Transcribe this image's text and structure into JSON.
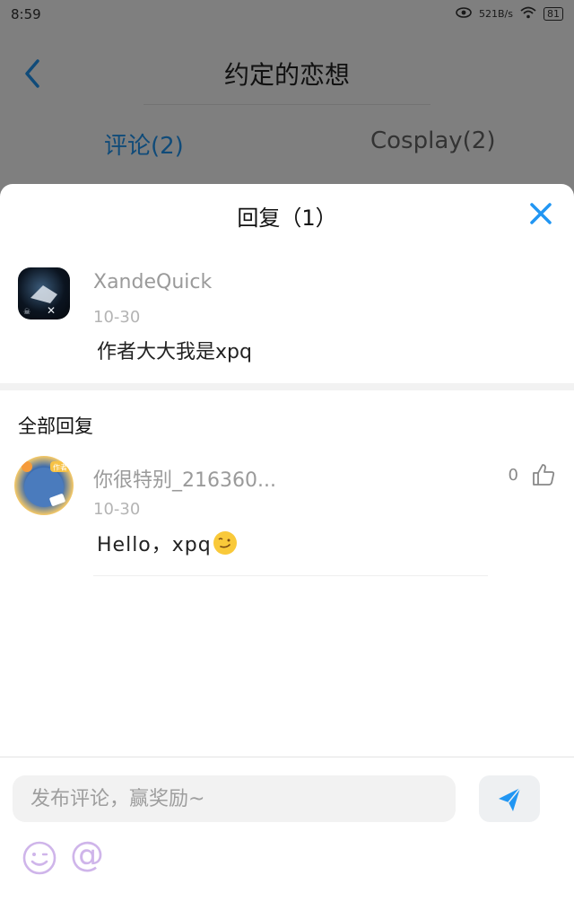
{
  "status_bar": {
    "time": "8:59",
    "network_speed": "521B/s",
    "battery": "81"
  },
  "header": {
    "title": "约定的恋想",
    "back_icon": "chevron-left-icon"
  },
  "tabs": [
    {
      "label": "评论(2)",
      "active": true
    },
    {
      "label": "Cosplay(2)",
      "active": false
    }
  ],
  "reply_sheet": {
    "title": "回复（1）",
    "close_icon": "close-icon",
    "original_comment": {
      "username": "XandeQuick",
      "date": "10-30",
      "content": "作者大大我是xpq"
    },
    "all_replies_label": "全部回复",
    "replies": [
      {
        "username": "你很特别_216360...",
        "date": "10-30",
        "content": "Hello，xpq",
        "emoji": "smirk-emoji",
        "likes": "0"
      }
    ]
  },
  "composer": {
    "placeholder": "发布评论，赢奖励~",
    "send_icon": "send-icon",
    "emoji_icon": "emoji-icon",
    "at_label": "@"
  },
  "colors": {
    "accent": "#2196f3",
    "close": "#2196f3",
    "send": "#2196f3",
    "emoji_button": "#cfb5ea",
    "overlay": "rgba(0,0,0,0.5)"
  }
}
